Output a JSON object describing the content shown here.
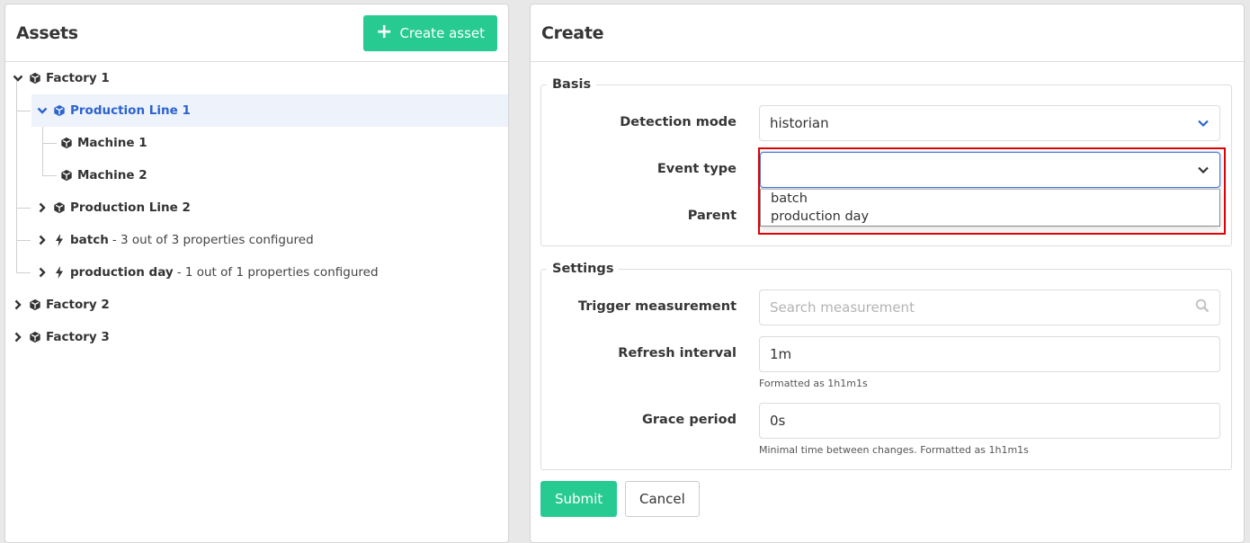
{
  "assets": {
    "title": "Assets",
    "create_button": "Create asset",
    "tree": [
      {
        "name": "Factory 1",
        "type": "asset",
        "expanded": true,
        "level": 0
      },
      {
        "name": "Production Line 1",
        "type": "asset",
        "expanded": true,
        "level": 1,
        "selected": true
      },
      {
        "name": "Machine 1",
        "type": "asset",
        "level": 2
      },
      {
        "name": "Machine 2",
        "type": "asset",
        "level": 2
      },
      {
        "name": "Production Line 2",
        "type": "asset",
        "expanded": false,
        "level": 1
      },
      {
        "name": "batch",
        "type": "event",
        "expanded": false,
        "level": 1,
        "description": "- 3 out of 3 properties configured"
      },
      {
        "name": "production day",
        "type": "event",
        "expanded": false,
        "level": 1,
        "description": "- 1 out of 1 properties configured"
      },
      {
        "name": "Factory 2",
        "type": "asset",
        "expanded": false,
        "level": 0
      },
      {
        "name": "Factory 3",
        "type": "asset",
        "expanded": false,
        "level": 0
      }
    ]
  },
  "create": {
    "title": "Create",
    "basis": {
      "legend": "Basis",
      "detection_mode": {
        "label": "Detection mode",
        "value": "historian"
      },
      "event_type": {
        "label": "Event type",
        "value": "",
        "options": [
          "batch",
          "production day"
        ]
      },
      "parent": {
        "label": "Parent"
      }
    },
    "settings": {
      "legend": "Settings",
      "trigger_measurement": {
        "label": "Trigger measurement",
        "placeholder": "Search measurement",
        "value": ""
      },
      "refresh_interval": {
        "label": "Refresh interval",
        "value": "1m",
        "help": "Formatted as 1h1m1s"
      },
      "grace_period": {
        "label": "Grace period",
        "value": "0s",
        "help": "Minimal time between changes. Formatted as 1h1m1s"
      }
    },
    "submit_label": "Submit",
    "cancel_label": "Cancel"
  },
  "colors": {
    "accent_green": "#27cb91",
    "selected_blue": "#2c63d1",
    "selected_row_bg": "#edf2fb",
    "highlight_red": "#e00000"
  }
}
